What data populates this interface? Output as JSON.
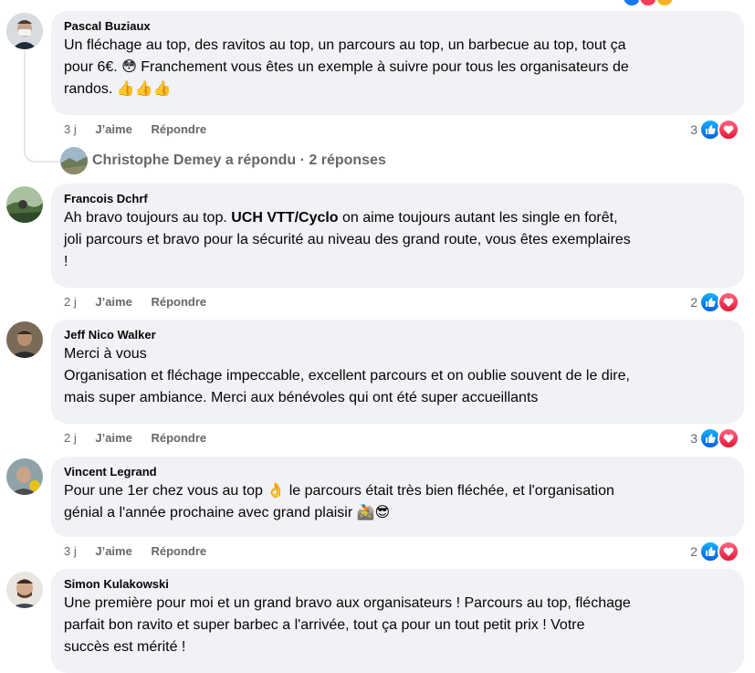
{
  "comments": [
    {
      "author": "Pascal Buziaux",
      "lines": [
        "Un fléchage au top, des ravitos au top, un parcours au top, un barbecue au top, tout ça",
        "pour 6€. 😳 Franchement vous êtes un exemple à suivre pour tous les organisateurs de",
        "randos. 👍👍👍"
      ],
      "time": "3 j",
      "like_label": "J’aime",
      "reply_label": "Répondre",
      "reaction_count": "3"
    },
    {
      "author": "Francois Dchrf",
      "line1_before": "Ah bravo toujours au top. ",
      "line1_mention": "UCH VTT/Cyclo",
      "line1_after": " on aime toujours autant les single en forêt,",
      "line2": "joli parcours et bravo pour la sécurité au niveau des grand route, vous êtes exemplaires",
      "line3": "!",
      "time": "2 j",
      "like_label": "J’aime",
      "reply_label": "Répondre",
      "reaction_count": "2"
    },
    {
      "author": "Jeff Nico Walker",
      "lines": [
        "Merci à vous",
        "Organisation et fléchage impeccable, excellent parcours et on oublie souvent de le dire,",
        "mais super ambiance. Merci aux bénévoles qui ont été super accueillants"
      ],
      "time": "2 j",
      "like_label": "J’aime",
      "reply_label": "Répondre",
      "reaction_count": "3"
    },
    {
      "author": "Vincent Legrand",
      "lines": [
        "Pour une 1er chez vous au top 👌 le parcours était très bien fléchée, et l'organisation",
        "génial a l'année prochaine avec grand plaisir 🚵😎"
      ],
      "time": "3 j",
      "like_label": "J’aime",
      "reply_label": "Répondre",
      "reaction_count": "2"
    },
    {
      "author": "Simon Kulakowski",
      "lines": [
        "Une première pour moi et un grand bravo aux organisateurs ! Parcours au top, fléchage",
        "parfait bon ravito et super barbec a l'arrivée, tout ça pour un tout petit prix ! Votre",
        "succès est mérité !"
      ]
    }
  ],
  "replies_summary": "Christophe Demey a répondu · 2 réponses",
  "colors": {
    "bubble": "#f0f2f5",
    "secondary_text": "#65676b",
    "like_blue": "#1877f2",
    "love_red": "#f33e58"
  }
}
